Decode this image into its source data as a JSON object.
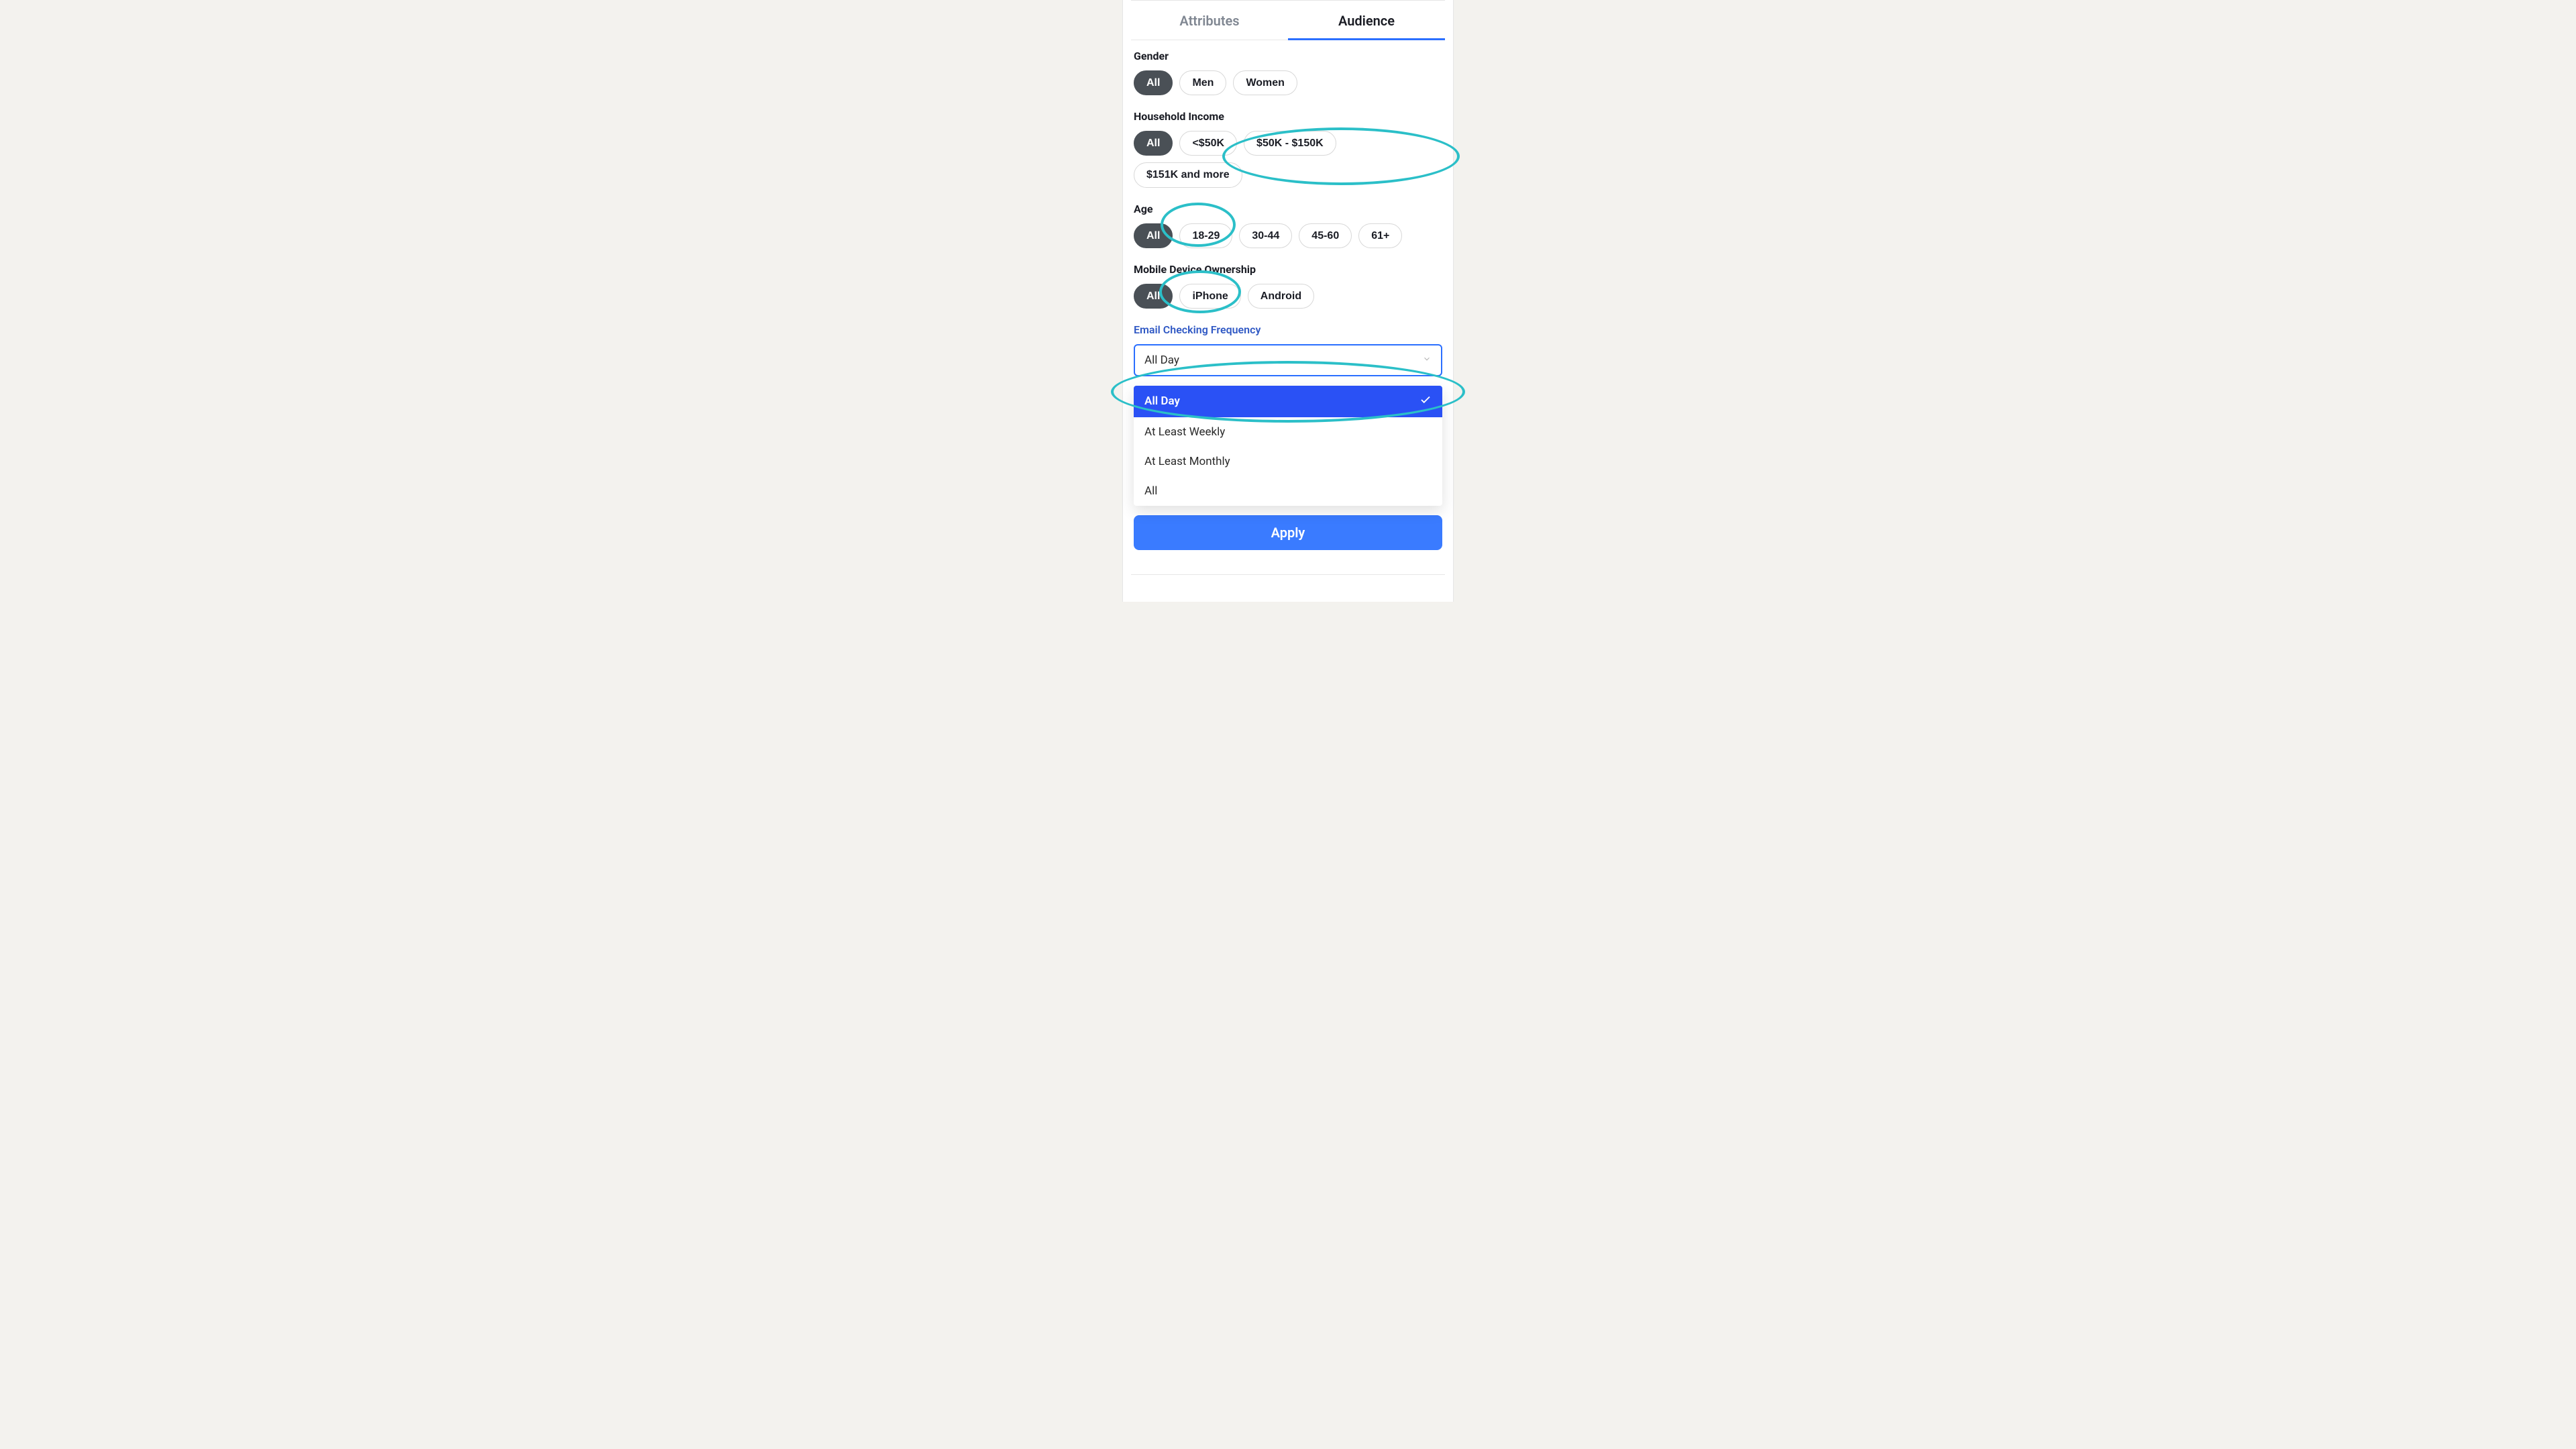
{
  "tabs": {
    "attributes": "Attributes",
    "audience": "Audience"
  },
  "gender": {
    "label": "Gender",
    "options": [
      "All",
      "Men",
      "Women"
    ],
    "selected": 0
  },
  "income": {
    "label": "Household Income",
    "options": [
      "All",
      "<$50K",
      "$50K - $150K",
      "$151K and more"
    ],
    "selected": 0
  },
  "age": {
    "label": "Age",
    "options": [
      "All",
      "18-29",
      "30-44",
      "45-60",
      "61+"
    ],
    "selected": 0
  },
  "device": {
    "label": "Mobile Device Ownership",
    "options": [
      "All",
      "iPhone",
      "Android"
    ],
    "selected": 0
  },
  "email_freq": {
    "label": "Email Checking Frequency",
    "value": "All Day",
    "options": [
      "All Day",
      "At Least Weekly",
      "At Least Monthly",
      "All"
    ],
    "selected": 0
  },
  "apply_label": "Apply",
  "colors": {
    "accent": "#2b6fff",
    "highlight": "#2bbfc8",
    "pill_selected": "#4a5056"
  }
}
